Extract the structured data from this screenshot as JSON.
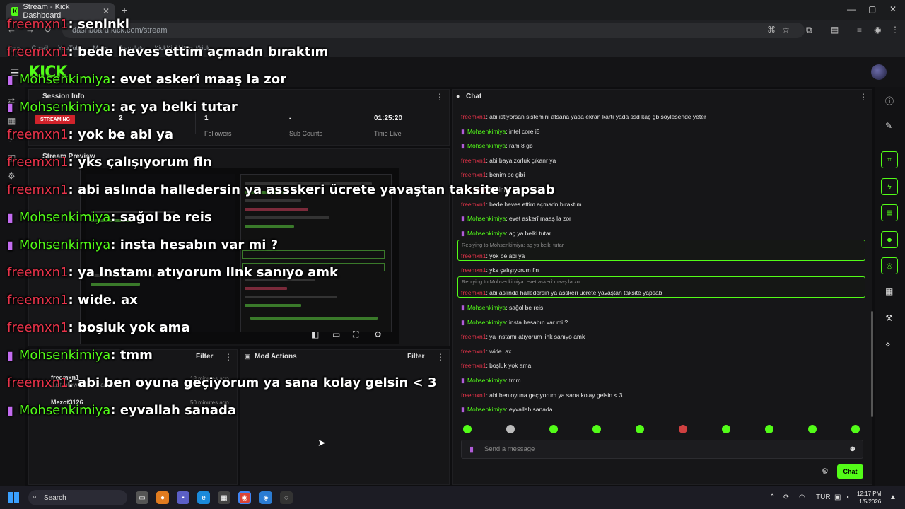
{
  "browser": {
    "tab_title": "Stream - Kick Dashboard",
    "url": "dashboard.kick.com/stream",
    "bookmarks": [
      "Apps",
      "Gmail",
      "YouTube",
      "Maps",
      "Translate",
      "KickKickHttps://kick"
    ]
  },
  "dashboard": {
    "logo": "KICK",
    "session": {
      "title": "Session Info",
      "badge": "STREAMING",
      "viewers": "2",
      "followers_value": "1",
      "followers_label": "Followers",
      "subs_value": "-",
      "subs_label": "Sub Counts",
      "time_value": "01:25:20",
      "time_label": "Time Live"
    },
    "preview": {
      "title": "Stream Preview"
    },
    "activity": {
      "filter": "Filter",
      "items": [
        {
          "name": "freemxn1",
          "sub": "Just followed the channel",
          "time": "18 minutes ago"
        },
        {
          "name": "Mezot3126",
          "sub": "",
          "time": "50 minutes ago"
        }
      ]
    },
    "mod_actions": {
      "title": "Mod Actions",
      "filter": "Filter"
    },
    "chat": {
      "title": "Chat",
      "placeholder": "Send a message",
      "send_label": "Chat",
      "messages": [
        {
          "user": "freemxn1",
          "color": "red",
          "mic": false,
          "text": ": abi istiyorsan sistemini atsana yada ekran kartı yada ssd kaç gb söylesende yeter"
        },
        {
          "user": "Mohsenkimiya",
          "color": "green",
          "mic": true,
          "text": ": intel core i5"
        },
        {
          "user": "Mohsenkimiya",
          "color": "green",
          "mic": true,
          "text": ": ram 8 gb"
        },
        {
          "user": "freemxn1",
          "color": "red",
          "mic": false,
          "text": ": abi baya zorluk çıkanr ya"
        },
        {
          "user": "freemxn1",
          "color": "red",
          "mic": false,
          "text": ": benim pc gibi"
        },
        {
          "user": "freemxn1",
          "color": "red",
          "mic": false,
          "text": ": seninki"
        },
        {
          "user": "freemxn1",
          "color": "red",
          "mic": false,
          "text": ": bede heves ettim açmadn bıraktım"
        },
        {
          "user": "Mohsenkimiya",
          "color": "green",
          "mic": true,
          "text": ": evet askerî maaş la zor"
        },
        {
          "user": "Mohsenkimiya",
          "color": "green",
          "mic": true,
          "text": ": aç ya belki tutar"
        },
        {
          "user": "freemxn1",
          "color": "red",
          "mic": false,
          "text": ": yok be abi ya",
          "reply": "Replying to Mohsenkimiya: aç ya belki tutar"
        },
        {
          "user": "freemxn1",
          "color": "red",
          "mic": false,
          "text": ": yks çalışıyorum fln"
        },
        {
          "user": "freemxn1",
          "color": "red",
          "mic": false,
          "text": ": abi aslında halledersin ya asskeri ücrete yavaştan taksite yapsab",
          "reply": "Replying to Mohsenkimiya: evet askerî maaş la zor"
        },
        {
          "user": "Mohsenkimiya",
          "color": "green",
          "mic": true,
          "text": ": sağol be reis"
        },
        {
          "user": "Mohsenkimiya",
          "color": "green",
          "mic": true,
          "text": ": insta hesabın var mi ?"
        },
        {
          "user": "freemxn1",
          "color": "red",
          "mic": false,
          "text": ": ya instamı atıyorum link sanıyo amk"
        },
        {
          "user": "freemxn1",
          "color": "red",
          "mic": false,
          "text": ": wide. ax"
        },
        {
          "user": "freemxn1",
          "color": "red",
          "mic": false,
          "text": ": boşluk yok ama"
        },
        {
          "user": "Mohsenkimiya",
          "color": "green",
          "mic": true,
          "text": ": tmm"
        },
        {
          "user": "freemxn1",
          "color": "red",
          "mic": false,
          "text": ": abi ben oyuna geçiyorum ya sana kolay gelsin < 3"
        },
        {
          "user": "Mohsenkimiya",
          "color": "green",
          "mic": true,
          "text": ": eyvallah sanada"
        }
      ]
    }
  },
  "overlay": {
    "lines": [
      {
        "user": "freemxn1",
        "color": "red",
        "mic": false,
        "text": ": seninki"
      },
      {
        "user": "freemxn1",
        "color": "red",
        "mic": false,
        "text": ": bede heves ettim açmadn bıraktım"
      },
      {
        "user": "Mohsenkimiya",
        "color": "green",
        "mic": true,
        "text": ": evet askerî maaş la zor"
      },
      {
        "user": "Mohsenkimiya",
        "color": "green",
        "mic": true,
        "text": ": aç ya belki tutar"
      },
      {
        "user": "freemxn1",
        "color": "red",
        "mic": false,
        "text": ": yok be abi ya"
      },
      {
        "user": "freemxn1",
        "color": "red",
        "mic": false,
        "text": ": yks çalışıyorum fln"
      },
      {
        "user": "freemxn1",
        "color": "red",
        "mic": false,
        "text": ": abi aslında halledersin ya assskeri ücrete yavaştan taksite yapsab"
      },
      {
        "user": "Mohsenkimiya",
        "color": "green",
        "mic": true,
        "text": ": sağol be reis"
      },
      {
        "user": "Mohsenkimiya",
        "color": "green",
        "mic": true,
        "text": ": insta hesabın var mi ?"
      },
      {
        "user": "freemxn1",
        "color": "red",
        "mic": false,
        "text": ": ya instamı atıyorum link sanıyo amk"
      },
      {
        "user": "freemxn1",
        "color": "red",
        "mic": false,
        "text": ": wide. ax"
      },
      {
        "user": "freemxn1",
        "color": "red",
        "mic": false,
        "text": ": boşluk yok ama"
      },
      {
        "user": "Mohsenkimiya",
        "color": "green",
        "mic": true,
        "text": ": tmm"
      },
      {
        "user": "freemxn1",
        "color": "red",
        "mic": false,
        "text": ": abi ben oyuna geçiyorum ya sana kolay gelsin < 3"
      },
      {
        "user": "Mohsenkimiya",
        "color": "green",
        "mic": true,
        "text": ": eyvallah sanada"
      }
    ]
  },
  "taskbar": {
    "search": "Search",
    "lang": "TUR",
    "time": "12:17 PM",
    "date": "1/5/2026"
  },
  "colors": {
    "kick_green": "#53fc18",
    "name_red": "#e8334a",
    "mic_purple": "#b05cd8"
  }
}
